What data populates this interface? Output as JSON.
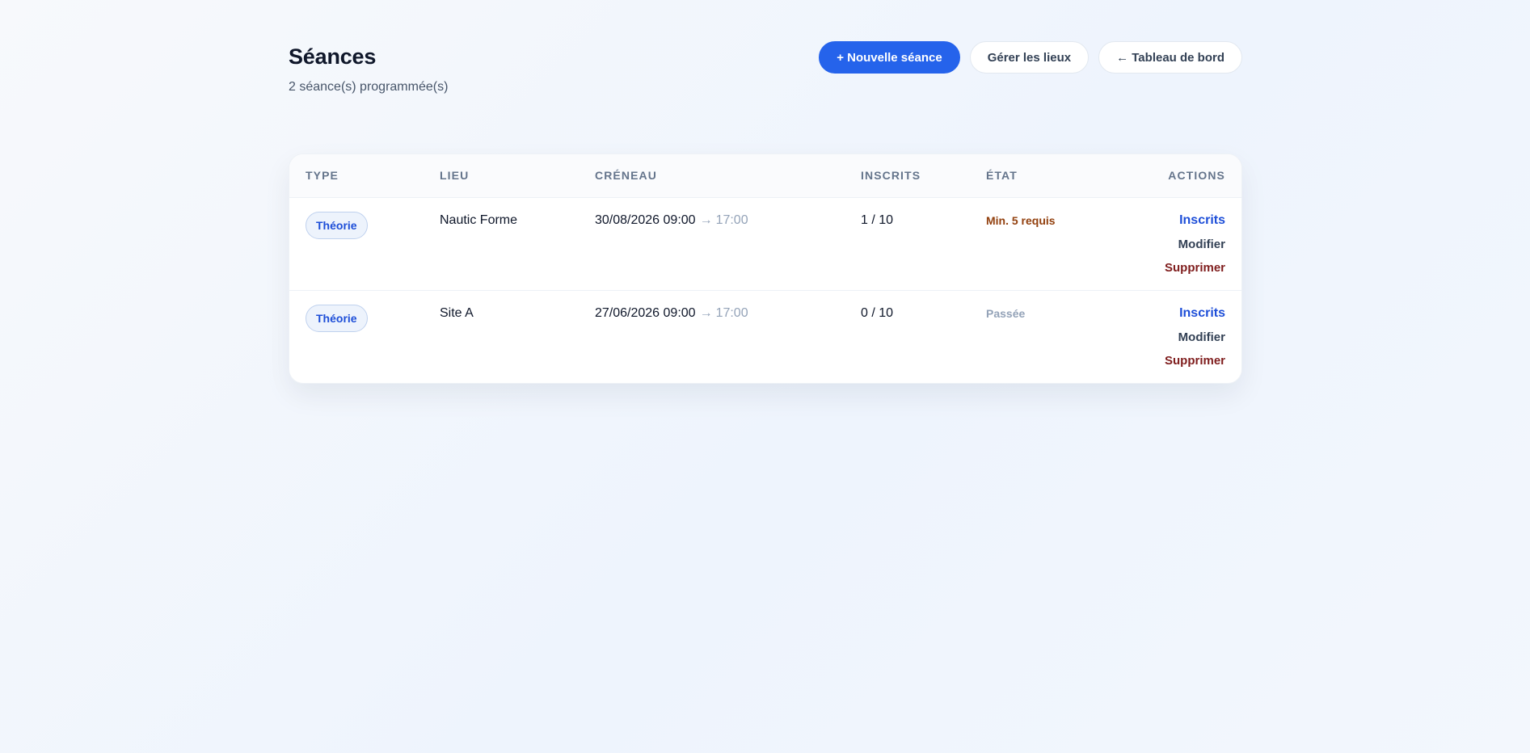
{
  "page": {
    "title": "Séances",
    "subtitle": "2 séance(s) programmée(s)"
  },
  "buttons": {
    "new_session": "+ Nouvelle séance",
    "manage_places": "Gérer les lieux",
    "dashboard": "← Tableau de bord"
  },
  "table": {
    "columns": {
      "type": "TYPE",
      "lieu": "LIEU",
      "creneau": "CRÉNEAU",
      "inscrits": "INSCRITS",
      "etat": "ÉTAT",
      "actions": "ACTIONS"
    },
    "rows": [
      {
        "type": "Théorie",
        "lieu": "Nautic Forme",
        "start": "30/08/2026 09:00",
        "arrow": "→",
        "end": "17:00",
        "inscrits": "1 / 10",
        "etat": "Min. 5 requis",
        "actions": {
          "inscrits": "Inscrits",
          "modifier": "Modifier",
          "supprimer": "Supprimer"
        }
      },
      {
        "type": "Théorie",
        "lieu": "Site A",
        "start": "27/06/2026 09:00",
        "arrow": "→",
        "end": "17:00",
        "inscrits": "0 / 10",
        "etat": "Passée",
        "actions": {
          "inscrits": "Inscrits",
          "modifier": "Modifier",
          "supprimer": "Supprimer"
        }
      }
    ]
  },
  "colors": {
    "primary": "#2563eb",
    "status_warning": "#92400e",
    "status_past": "#94a3b8",
    "danger": "#7f1d1d"
  }
}
